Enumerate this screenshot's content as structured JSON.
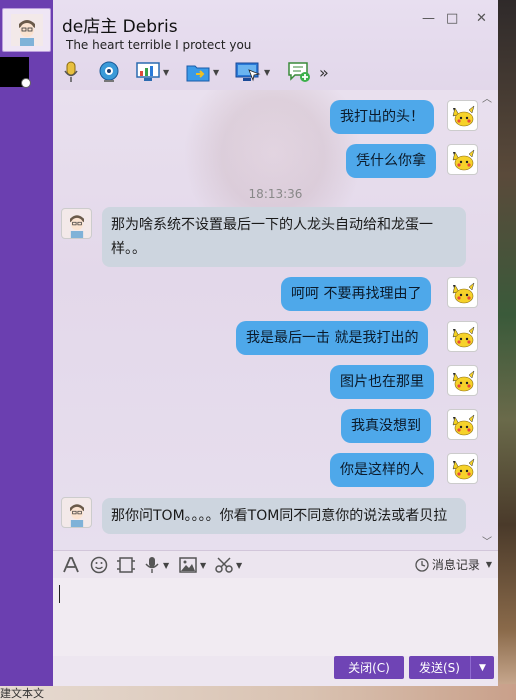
{
  "contact": {
    "name": "de店主 Debris",
    "signature": "The heart terrible   I protect you"
  },
  "window_controls": {
    "minimize": "—",
    "maximize": "□",
    "close": "✕"
  },
  "toolbar": {
    "items": [
      "mic-icon",
      "video-call-icon",
      "screen-share-icon",
      "file-transfer-icon",
      "remote-assist-icon",
      "add-app-icon",
      "more-icon"
    ],
    "more_label": "»"
  },
  "messages": {
    "m1": "我打出的头！",
    "m2": "凭什么你拿",
    "timestamp": "18:13:36",
    "m3": "那为啥系统不设置最后一下的人龙头自动给和龙蛋一样。。",
    "m4": "呵呵 不要再找理由了",
    "m5": "我是最后一击 就是我打出的",
    "m6": "图片也在那里",
    "m7": "我真没想到",
    "m8": "你是这样的人",
    "m9": "那你问TOM。。。。你看TOM同不同意你的说法或者贝拉"
  },
  "input_toolbar": {
    "history_label": "消息记录",
    "icons": [
      "font-icon",
      "emoji-icon",
      "screenshot-icon",
      "voice-icon",
      "image-icon",
      "scissors-icon"
    ]
  },
  "footer": {
    "close_label": "关闭(C)",
    "send_label": "发送(S)"
  },
  "desktop": {
    "bottom_text": "建文本文"
  },
  "colors": {
    "accent": "#6f44b5",
    "bubble_out": "#4ea8ea",
    "bubble_in": "#cdd5df",
    "rail": "#6b3fb0"
  }
}
